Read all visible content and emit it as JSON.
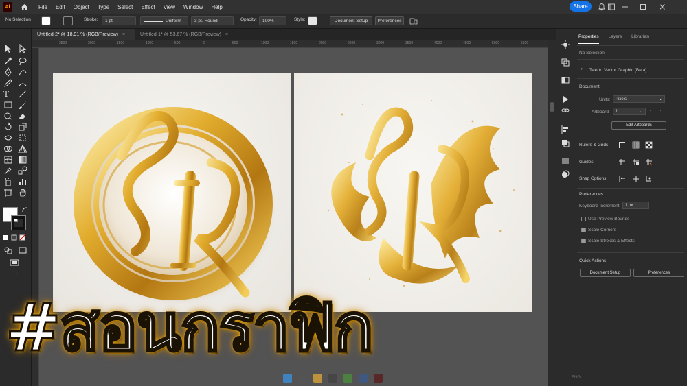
{
  "app": {
    "logo_text": "Ai"
  },
  "menubar": {
    "items": [
      "File",
      "Edit",
      "Object",
      "Type",
      "Select",
      "Effect",
      "View",
      "Window",
      "Help"
    ],
    "share_label": "Share"
  },
  "control_bar": {
    "selection": "No Selection",
    "stroke_label": "Stroke:",
    "stroke_value": "1 pt",
    "profile_label": "Uniform",
    "brush_label": "3 pt. Round",
    "opacity_label": "Opacity:",
    "opacity_value": "100%",
    "style_label": "Style:",
    "doc_setup_label": "Document Setup",
    "preferences_label": "Preferences"
  },
  "tabs": [
    {
      "label": "Untitled-2* @ 18.91 % (RGB/Preview)",
      "active": true
    },
    {
      "label": "Untitled-1* @ 53.67 % (RGB/Preview)",
      "active": false
    }
  ],
  "ruler": {
    "labels": [
      "2500",
      "2000",
      "1500",
      "1000",
      "500",
      "0",
      "500",
      "1000",
      "1500",
      "2000",
      "2500",
      "3000",
      "3500",
      "4000",
      "4500",
      "5000",
      "5500",
      "6000"
    ]
  },
  "panel": {
    "tabs": [
      "Properties",
      "Layers",
      "Libraries"
    ],
    "no_selection": "No Selection",
    "text_to_vector": "Text to Vector Graphic (Beta)",
    "document_heading": "Document",
    "units_label": "Units:",
    "units_value": "Pixels",
    "artboard_label": "Artboard:",
    "artboard_value": "1",
    "edit_artboards": "Edit Artboards",
    "rulers_grids": "Rulers & Grids",
    "guides": "Guides",
    "snap_options": "Snap Options",
    "preferences_heading": "Preferences",
    "keyboard_increment_label": "Keyboard Increment:",
    "keyboard_increment_value": "1 px",
    "use_preview_bounds": "Use Preview Bounds",
    "scale_corners": "Scale Corners",
    "scale_strokes": "Scale Strokes & Effects",
    "quick_actions": "Quick Actions",
    "document_setup": "Document Setup",
    "preferences_btn": "Preferences"
  },
  "checkboxes": {
    "use_preview_bounds": false,
    "scale_corners": true,
    "scale_strokes": true
  },
  "overlay": {
    "text": "#สอนกราฟิก"
  },
  "taskbar": {
    "lang": "ENG"
  },
  "colors": {
    "accent": "#1473e6",
    "gold": "#d9a520",
    "bg": "#1e1e1e",
    "panel": "#2b2b2b"
  }
}
